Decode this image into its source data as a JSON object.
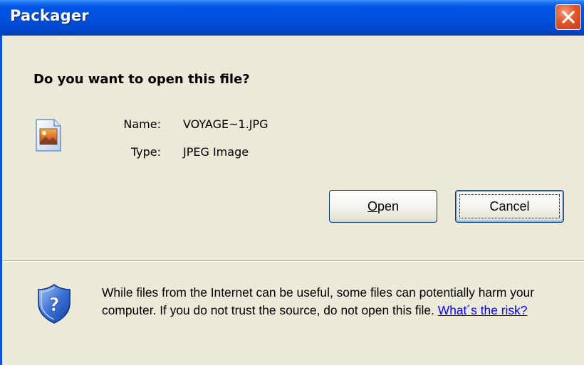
{
  "window": {
    "title": "Packager",
    "close_icon": "close-icon"
  },
  "dialog": {
    "question": "Do you want to open this file?",
    "file_icon": "jpeg-image-file-icon",
    "name_label": "Name:",
    "name_value": "VOYAGE~1.JPG",
    "type_label": "Type:",
    "type_value": "JPEG Image"
  },
  "buttons": {
    "open_mnemonic": "O",
    "open_rest": "pen",
    "cancel": "Cancel"
  },
  "warning": {
    "icon": "security-shield-question-icon",
    "text": "While files from the Internet can be useful, some files can potentially harm your computer. If you do not trust the source, do not open this file.",
    "link": "What´s the risk?"
  },
  "colors": {
    "titlebar": "#0055e5",
    "dialog_bg": "#ece9d8",
    "link": "#0000ff",
    "close_button": "#e2572e"
  }
}
